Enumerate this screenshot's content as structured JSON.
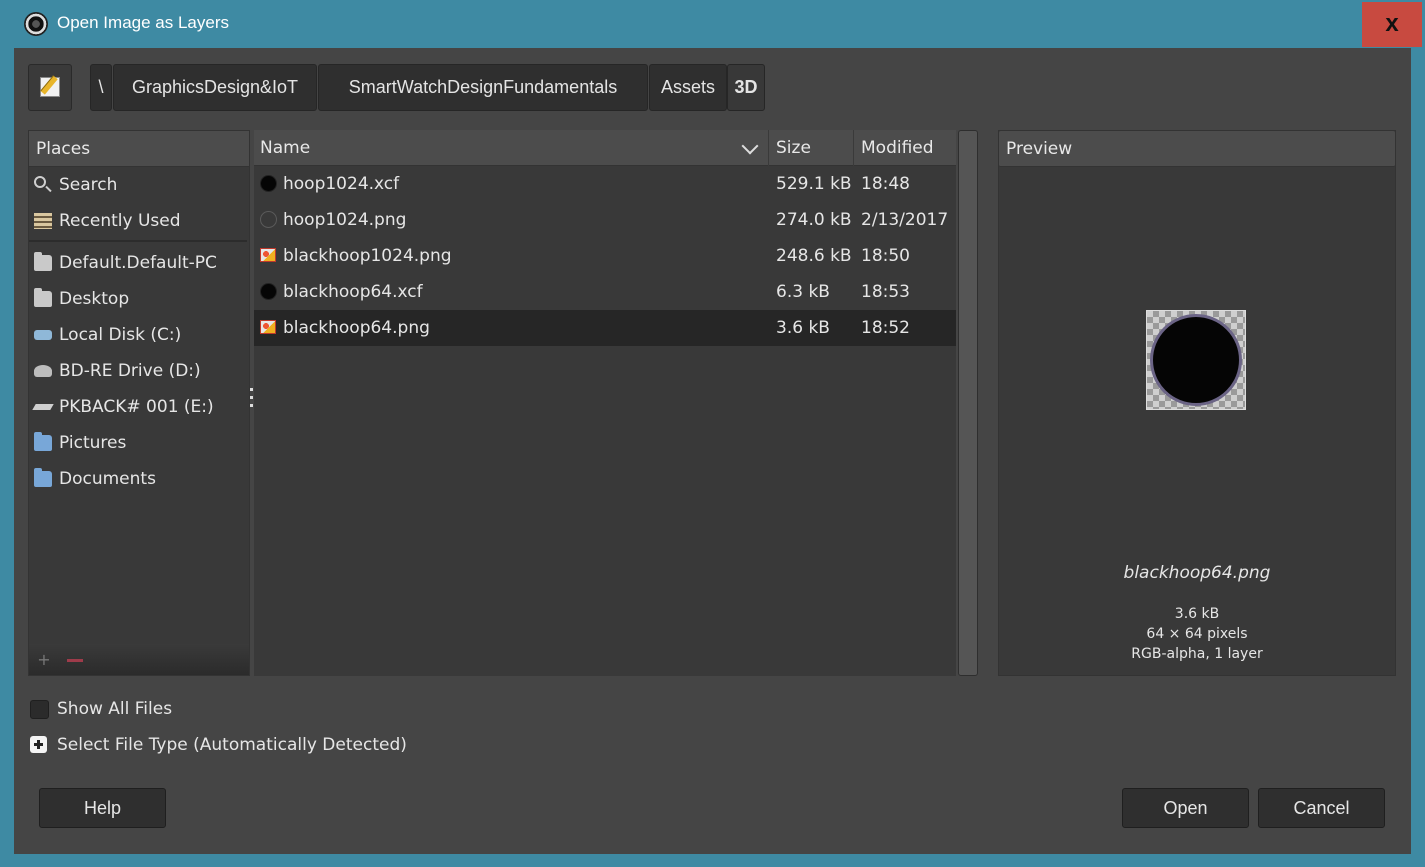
{
  "window": {
    "title": "Open Image as Layers",
    "close_label": "x"
  },
  "toolbar": {
    "edit_location_icon": "edit-location-icon",
    "breadcrumbs": [
      {
        "label": "\\"
      },
      {
        "label": "GraphicsDesign&IoT"
      },
      {
        "label": "SmartWatchDesignFundamentals"
      },
      {
        "label": "Assets"
      },
      {
        "label": "3D",
        "active": true
      }
    ]
  },
  "places": {
    "header": "Places",
    "items": [
      {
        "label": "Search",
        "icon": "search-icon"
      },
      {
        "label": "Recently Used",
        "icon": "recently-used-icon"
      },
      {
        "label": "Default.Default-PC",
        "icon": "folder-icon"
      },
      {
        "label": "Desktop",
        "icon": "folder-icon"
      },
      {
        "label": "Local Disk (C:)",
        "icon": "disk-icon"
      },
      {
        "label": "BD-RE Drive (D:)",
        "icon": "optical-drive-icon"
      },
      {
        "label": "PKBACK# 001 (E:)",
        "icon": "usb-drive-icon"
      },
      {
        "label": "Pictures",
        "icon": "folder-icon"
      },
      {
        "label": "Documents",
        "icon": "folder-icon"
      }
    ]
  },
  "files": {
    "columns": {
      "name": "Name",
      "size": "Size",
      "modified": "Modified"
    },
    "rows": [
      {
        "name": "hoop1024.xcf",
        "size": "529.1 kB",
        "modified": "18:48",
        "icon": "xcf-file-icon"
      },
      {
        "name": "hoop1024.png",
        "size": "274.0 kB",
        "modified": "2/13/2017",
        "icon": "png-hoop-icon"
      },
      {
        "name": "blackhoop1024.png",
        "size": "248.6 kB",
        "modified": "18:50",
        "icon": "image-file-icon"
      },
      {
        "name": "blackhoop64.xcf",
        "size": "6.3 kB",
        "modified": "18:53",
        "icon": "xcf-file-icon"
      },
      {
        "name": "blackhoop64.png",
        "size": "3.6 kB",
        "modified": "18:52",
        "icon": "image-file-icon",
        "selected": true
      }
    ]
  },
  "preview": {
    "header": "Preview",
    "file_name": "blackhoop64.png",
    "size": "3.6 kB",
    "dimensions": "64 × 64 pixels",
    "info": "RGB-alpha, 1 layer"
  },
  "options": {
    "show_all_files": "Show All Files",
    "select_file_type": "Select File Type (Automatically Detected)"
  },
  "buttons": {
    "help": "Help",
    "open": "Open",
    "cancel": "Cancel"
  },
  "colors": {
    "title_bar": "#3e8aa3",
    "close": "#c84a40",
    "background": "#454545",
    "selected_row": "#262626"
  }
}
